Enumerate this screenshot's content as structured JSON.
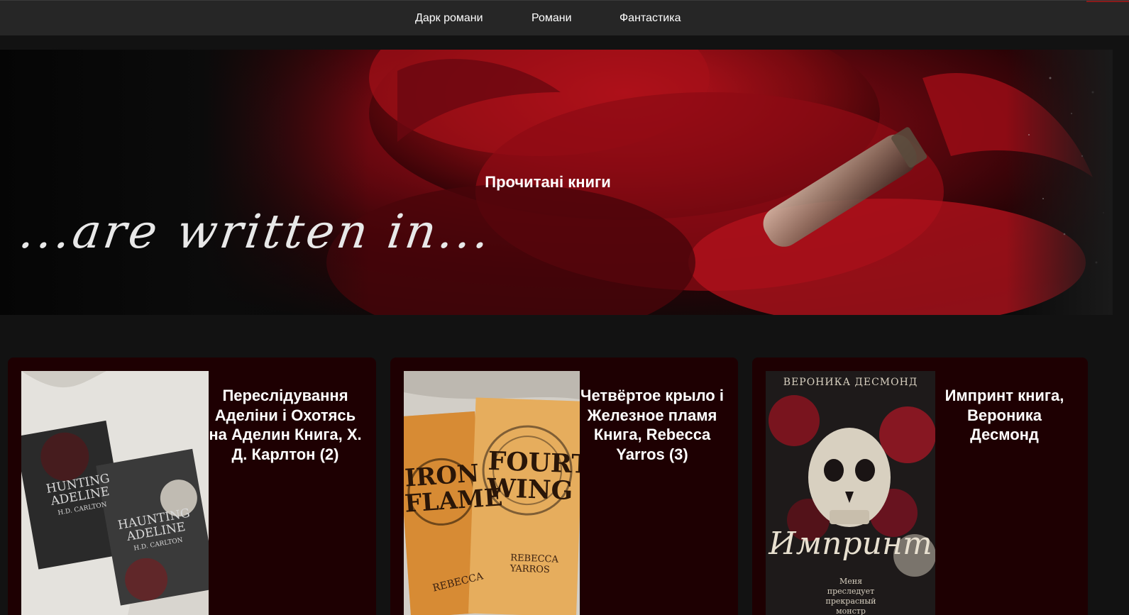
{
  "nav": {
    "items": [
      "Дарк романи",
      "Романи",
      "Фантастика"
    ]
  },
  "hero": {
    "title": "Прочитані книги",
    "script_text": "...are written in..."
  },
  "books": [
    {
      "title": "Переслідування Аделіни і Охотясь на Аделин Книга, Х. Д. Карлтон (2)",
      "cover": {
        "book1": [
          "HUNTING",
          "ADELINE",
          "H.D. CARLTON"
        ],
        "book2": [
          "HAUNTING",
          "ADELINE",
          "H.D. CARLTON"
        ]
      }
    },
    {
      "title": "Четвёртое крыло і Железное пламя Книга, Rebecca Yarros (3)",
      "cover": {
        "book1": [
          "IRON",
          "FLAME",
          "REBECCA"
        ],
        "book2": [
          "FOURTH",
          "WING",
          "REBECCA YARROS"
        ]
      }
    },
    {
      "title": "Импринт книга, Вероника Десмонд",
      "cover": {
        "author": "ВЕРОНИКА ДЕСМОНД",
        "title": "Импринт",
        "tagline": "Меня преследует прекрасный монстр"
      }
    }
  ],
  "colors": {
    "background": "#121212",
    "nav_bg": "#262626",
    "card_bg": "#1e0002",
    "accent_red": "#a4101a"
  }
}
